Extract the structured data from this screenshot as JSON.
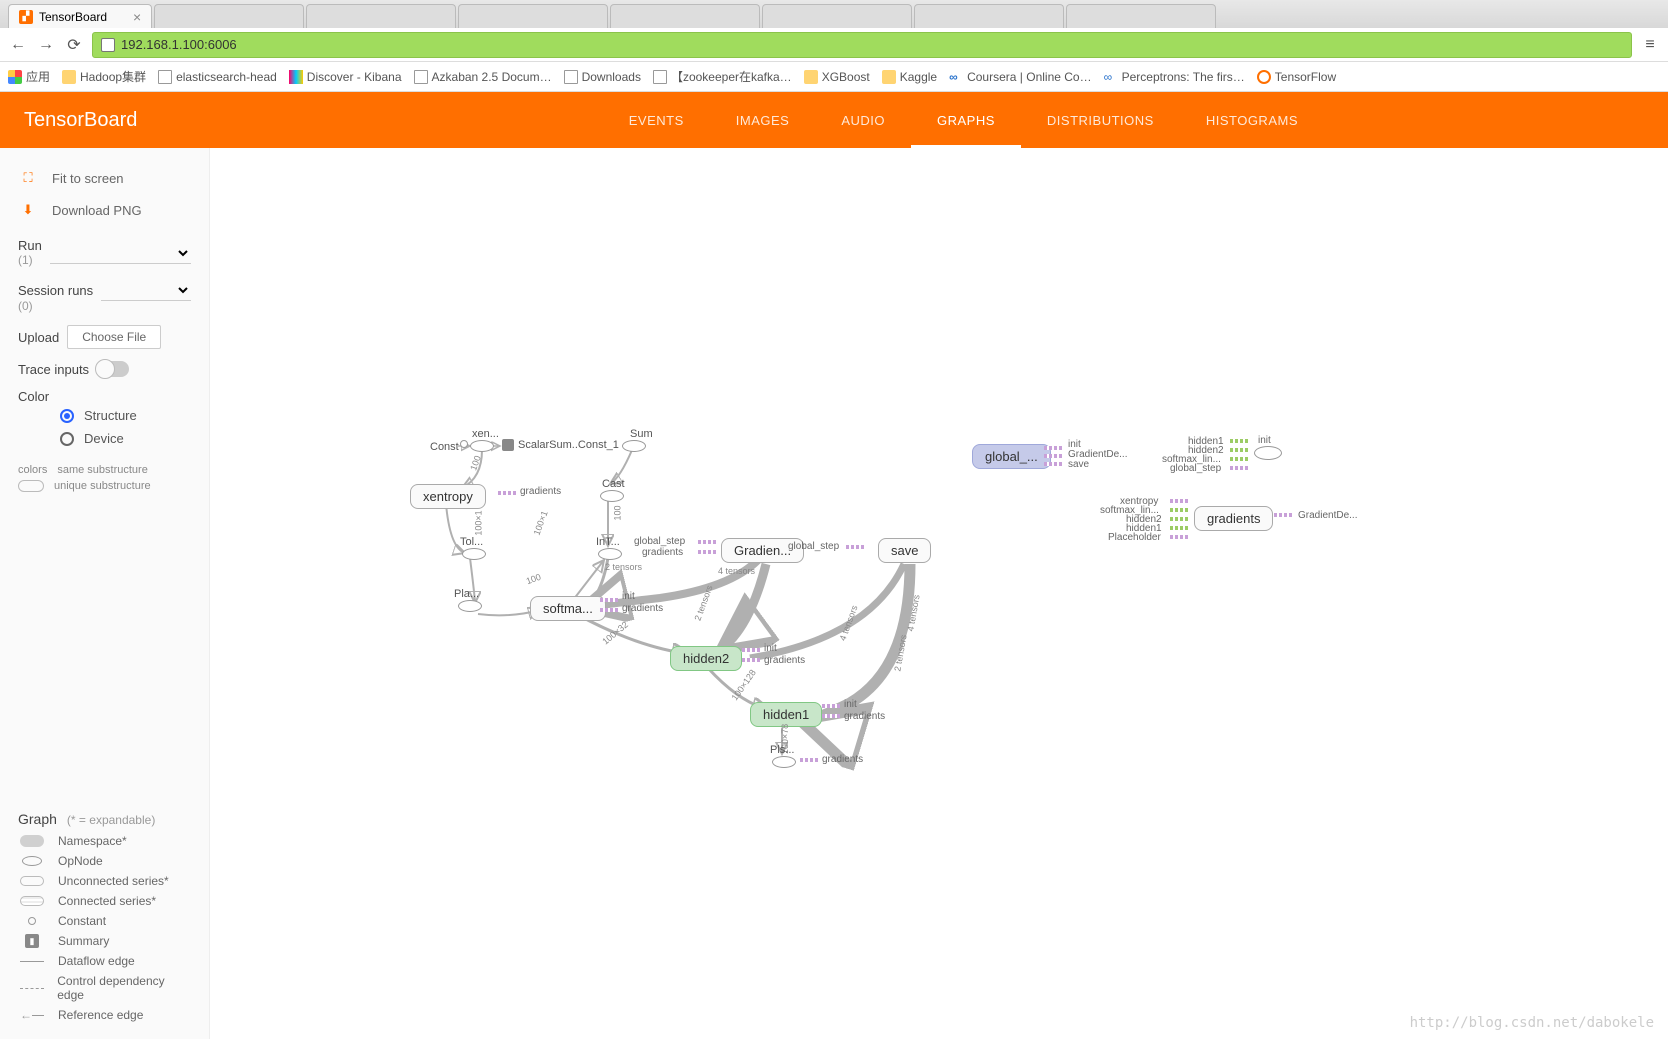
{
  "browser": {
    "active_tab_title": "TensorBoard",
    "url": "192.168.1.100:6006",
    "apps_label": "应用",
    "bookmarks": [
      {
        "label": "Hadoop集群",
        "type": "folder"
      },
      {
        "label": "elasticsearch-head",
        "type": "page"
      },
      {
        "label": "Discover - Kibana",
        "type": "app"
      },
      {
        "label": "Azkaban 2.5 Docum…",
        "type": "page"
      },
      {
        "label": "Downloads",
        "type": "page"
      },
      {
        "label": "【zookeeper在kafka…",
        "type": "doc"
      },
      {
        "label": "XGBoost",
        "type": "folder"
      },
      {
        "label": "Kaggle",
        "type": "folder"
      },
      {
        "label": "Coursera | Online Co…",
        "type": "link"
      },
      {
        "label": "Perceptrons: The firs…",
        "type": "link"
      },
      {
        "label": "TensorFlow",
        "type": "link"
      }
    ]
  },
  "tensorboard": {
    "title": "TensorBoard",
    "tabs": [
      "EVENTS",
      "IMAGES",
      "AUDIO",
      "GRAPHS",
      "DISTRIBUTIONS",
      "HISTOGRAMS"
    ],
    "active_tab": "GRAPHS"
  },
  "sidebar": {
    "fit": "Fit to screen",
    "download": "Download PNG",
    "run_label": "Run",
    "run_count": "(1)",
    "session_label": "Session runs",
    "session_count": "(0)",
    "upload_label": "Upload",
    "choose_file": "Choose File",
    "trace_label": "Trace inputs",
    "color_label": "Color",
    "color_options": [
      "Structure",
      "Device"
    ],
    "colors_word": "colors",
    "same_sub": "same substructure",
    "unique_sub": "unique substructure",
    "legend_title": "Graph",
    "legend_note": "(* = expandable)",
    "legend": [
      "Namespace*",
      "OpNode",
      "Unconnected series*",
      "Connected series*",
      "Constant",
      "Summary",
      "Dataflow edge",
      "Control dependency edge",
      "Reference edge"
    ]
  },
  "graph": {
    "nodes": {
      "const": "Const",
      "xen": "xen...",
      "sum": "Sum",
      "scalarsum": "ScalarSum..Const_1",
      "cast": "Cast",
      "xentropy": "xentropy",
      "gradients_lbl": "gradients",
      "tol": "Tol...",
      "int": "InT...",
      "pla": "Pla...",
      "global_step_lbl": "global_step",
      "gradients_lbl2": "gradients",
      "two_tensors": "2 tensors",
      "four_tensors": "4 tensors",
      "gradien": "Gradien...",
      "save": "save",
      "softma": "softma...",
      "init": "init",
      "hidden2": "hidden2",
      "hidden1": "hidden1",
      "pls": "Pls...",
      "global": "global_...",
      "gradientde": "GradientDe...",
      "gradients_node": "gradients",
      "hidden1_l": "hidden1",
      "hidden2_l": "hidden2",
      "softmax_lin": "softmax_lin...",
      "global_step_l": "global_step",
      "xentropy_l": "xentropy",
      "placeholder": "Placeholder",
      "e100": "100",
      "e100x": "100×1",
      "e100x2": "100×2",
      "e100x32": "100×32",
      "e100x128": "100×128",
      "e100x78": "100×78"
    }
  },
  "watermark": "http://blog.csdn.net/dabokele"
}
